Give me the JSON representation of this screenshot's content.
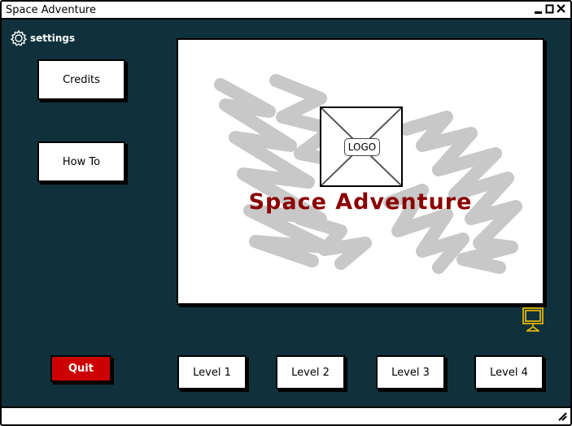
{
  "window": {
    "title": "Space Adventure"
  },
  "toolbar": {
    "settings_label": "settings"
  },
  "menu": {
    "credits_label": "Credits",
    "howto_label": "How To",
    "quit_label": "Quit"
  },
  "splash": {
    "logo_label": "LOGO",
    "game_title": "Space Adventure"
  },
  "levels": [
    {
      "label": "Level 1"
    },
    {
      "label": "Level 2"
    },
    {
      "label": "Level 3"
    },
    {
      "label": "Level 4"
    }
  ],
  "icons": {
    "settings": "gear-icon",
    "display": "monitor-icon",
    "minimize": "minimize-icon",
    "maximize": "maximize-icon",
    "close": "close-icon",
    "resize": "resize-grip-icon"
  },
  "colors": {
    "background": "#10313b",
    "quit_button": "#cc0000",
    "game_title": "#8b0000",
    "monitor_icon": "#e0b400",
    "scribble": "#c8c8c8"
  }
}
